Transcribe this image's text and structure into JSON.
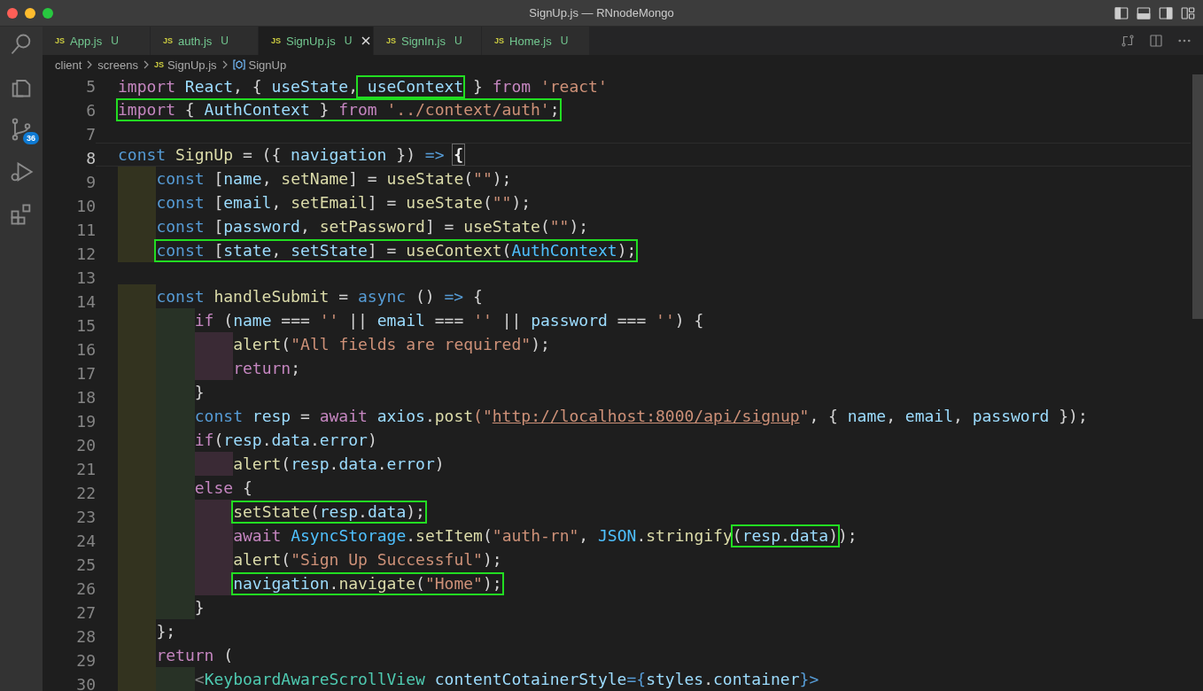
{
  "window": {
    "title": "SignUp.js — RNnodeMongo"
  },
  "activity_bar": {
    "source_control_badge": "36"
  },
  "tabs": [
    {
      "icon": "JS",
      "label": "App.js",
      "status": "U",
      "selected": false
    },
    {
      "icon": "JS",
      "label": "auth.js",
      "status": "U",
      "selected": false
    },
    {
      "icon": "JS",
      "label": "SignUp.js",
      "status": "U",
      "selected": true
    },
    {
      "icon": "JS",
      "label": "SignIn.js",
      "status": "U",
      "selected": false
    },
    {
      "icon": "JS",
      "label": "Home.js",
      "status": "U",
      "selected": false
    }
  ],
  "breadcrumbs": [
    {
      "kind": "folder",
      "label": "client"
    },
    {
      "kind": "folder",
      "label": "screens"
    },
    {
      "kind": "file",
      "icon": "JS",
      "label": "SignUp.js"
    },
    {
      "kind": "symbol",
      "label": "SignUp"
    }
  ],
  "editor": {
    "lines": [
      {
        "number": "5",
        "current": false,
        "parts": [
          {
            "boxed": false,
            "tokens": [
              {
                "text": "import",
                "kind": "keyword"
              },
              {
                "text": " React",
                "kind": "var"
              },
              {
                "text": ", { ",
                "kind": "punct"
              },
              {
                "text": "useState",
                "kind": "var"
              },
              {
                "text": ",",
                "kind": "punct"
              }
            ]
          },
          {
            "boxed": true,
            "tokens": [
              {
                "text": " useContext",
                "kind": "var"
              }
            ]
          },
          {
            "boxed": false,
            "tokens": [
              {
                "text": " } ",
                "kind": "punct"
              },
              {
                "text": "from",
                "kind": "keyword"
              },
              {
                "text": " 'react'",
                "kind": "string"
              }
            ]
          }
        ]
      },
      {
        "number": "6",
        "current": false,
        "parts": [
          {
            "boxed": true,
            "tokens": [
              {
                "text": "import",
                "kind": "keyword"
              },
              {
                "text": " { ",
                "kind": "punct"
              },
              {
                "text": "AuthContext",
                "kind": "var"
              },
              {
                "text": " } ",
                "kind": "punct"
              },
              {
                "text": "from",
                "kind": "keyword"
              },
              {
                "text": " '../context/auth'",
                "kind": "string"
              },
              {
                "text": ";",
                "kind": "punct"
              }
            ]
          }
        ]
      },
      {
        "number": "7",
        "current": false
      },
      {
        "number": "8",
        "current": true,
        "parts": [
          {
            "boxed": false,
            "tokens": [
              {
                "text": "const",
                "kind": "storage"
              },
              {
                "text": " SignUp",
                "kind": "function"
              },
              {
                "text": " = ({ ",
                "kind": "punct"
              },
              {
                "text": "navigation",
                "kind": "var"
              },
              {
                "text": " }) ",
                "kind": "punct"
              },
              {
                "text": "=>",
                "kind": "storage"
              },
              {
                "text": " {",
                "kind": "matched-bracket"
              }
            ]
          }
        ]
      },
      {
        "number": "9",
        "current": false,
        "parts": [
          {
            "boxed": false,
            "tokens": [
              {
                "text": "    const",
                "kind": "storage"
              },
              {
                "text": " [",
                "kind": "punct"
              },
              {
                "text": "name",
                "kind": "var"
              },
              {
                "text": ", ",
                "kind": "punct"
              },
              {
                "text": "setName",
                "kind": "function"
              },
              {
                "text": "] = ",
                "kind": "punct"
              },
              {
                "text": "useState",
                "kind": "function"
              },
              {
                "text": "(",
                "kind": "punct"
              },
              {
                "text": "\"\"",
                "kind": "string"
              },
              {
                "text": ");",
                "kind": "punct"
              }
            ]
          }
        ]
      },
      {
        "number": "10",
        "current": false,
        "parts": [
          {
            "boxed": false,
            "tokens": [
              {
                "text": "    const",
                "kind": "storage"
              },
              {
                "text": " [",
                "kind": "punct"
              },
              {
                "text": "email",
                "kind": "var"
              },
              {
                "text": ", ",
                "kind": "punct"
              },
              {
                "text": "setEmail",
                "kind": "function"
              },
              {
                "text": "] = ",
                "kind": "punct"
              },
              {
                "text": "useState",
                "kind": "function"
              },
              {
                "text": "(",
                "kind": "punct"
              },
              {
                "text": "\"\"",
                "kind": "string"
              },
              {
                "text": ");",
                "kind": "punct"
              }
            ]
          }
        ]
      },
      {
        "number": "11",
        "current": false,
        "parts": [
          {
            "boxed": false,
            "tokens": [
              {
                "text": "    const",
                "kind": "storage"
              },
              {
                "text": " [",
                "kind": "punct"
              },
              {
                "text": "password",
                "kind": "var"
              },
              {
                "text": ", ",
                "kind": "punct"
              },
              {
                "text": "setPassword",
                "kind": "function"
              },
              {
                "text": "] = ",
                "kind": "punct"
              },
              {
                "text": "useState",
                "kind": "function"
              },
              {
                "text": "(",
                "kind": "punct"
              },
              {
                "text": "\"\"",
                "kind": "string"
              },
              {
                "text": ");",
                "kind": "punct"
              }
            ]
          }
        ]
      },
      {
        "number": "12",
        "current": false,
        "parts": [
          {
            "boxed": true,
            "tokens": [
              {
                "text": "    const",
                "kind": "storage"
              },
              {
                "text": " [",
                "kind": "punct"
              },
              {
                "text": "state",
                "kind": "var"
              },
              {
                "text": ", ",
                "kind": "punct"
              },
              {
                "text": "setState",
                "kind": "var"
              },
              {
                "text": "] = ",
                "kind": "punct"
              },
              {
                "text": "useContext",
                "kind": "function"
              },
              {
                "text": "(",
                "kind": "punct"
              },
              {
                "text": "AuthContext",
                "kind": "constant"
              },
              {
                "text": ");",
                "kind": "punct"
              }
            ]
          }
        ]
      },
      {
        "number": "13",
        "current": false
      },
      {
        "number": "14",
        "current": false,
        "parts": [
          {
            "boxed": false,
            "tokens": [
              {
                "text": "    const",
                "kind": "storage"
              },
              {
                "text": " handleSubmit",
                "kind": "function"
              },
              {
                "text": " = ",
                "kind": "punct"
              },
              {
                "text": "async",
                "kind": "storage"
              },
              {
                "text": " () ",
                "kind": "punct"
              },
              {
                "text": "=>",
                "kind": "storage"
              },
              {
                "text": " {",
                "kind": "punct"
              }
            ]
          }
        ]
      },
      {
        "number": "15",
        "current": false,
        "parts": [
          {
            "boxed": false,
            "tokens": [
              {
                "text": "        if",
                "kind": "keyword"
              },
              {
                "text": " (",
                "kind": "punct"
              },
              {
                "text": "name",
                "kind": "var"
              },
              {
                "text": " === ",
                "kind": "punct"
              },
              {
                "text": "''",
                "kind": "string"
              },
              {
                "text": " || ",
                "kind": "punct"
              },
              {
                "text": "email",
                "kind": "var"
              },
              {
                "text": " === ",
                "kind": "punct"
              },
              {
                "text": "''",
                "kind": "string"
              },
              {
                "text": " || ",
                "kind": "punct"
              },
              {
                "text": "password",
                "kind": "var"
              },
              {
                "text": " === ",
                "kind": "punct"
              },
              {
                "text": "''",
                "kind": "string"
              },
              {
                "text": ") {",
                "kind": "punct"
              }
            ]
          }
        ]
      },
      {
        "number": "16",
        "current": false,
        "parts": [
          {
            "boxed": false,
            "tokens": [
              {
                "text": "            alert",
                "kind": "function"
              },
              {
                "text": "(",
                "kind": "punct"
              },
              {
                "text": "\"All fields are required\"",
                "kind": "string"
              },
              {
                "text": ");",
                "kind": "punct"
              }
            ]
          }
        ]
      },
      {
        "number": "17",
        "current": false,
        "parts": [
          {
            "boxed": false,
            "tokens": [
              {
                "text": "            return",
                "kind": "keyword"
              },
              {
                "text": ";",
                "kind": "punct"
              }
            ]
          }
        ]
      },
      {
        "number": "18",
        "current": false,
        "parts": [
          {
            "boxed": false,
            "tokens": [
              {
                "text": "        }",
                "kind": "punct"
              }
            ]
          }
        ]
      },
      {
        "number": "19",
        "current": false,
        "parts": [
          {
            "boxed": false,
            "tokens": [
              {
                "text": "        const",
                "kind": "storage"
              },
              {
                "text": " resp",
                "kind": "var"
              },
              {
                "text": " = ",
                "kind": "punct"
              },
              {
                "text": "await",
                "kind": "keyword"
              },
              {
                "text": " axios",
                "kind": "var"
              },
              {
                "text": ".",
                "kind": "punct"
              },
              {
                "text": "post",
                "kind": "function"
              },
              {
                "text": "(\"",
                "kind": "string"
              },
              {
                "text": "http://localhost:8000/api/signup",
                "kind": "link"
              },
              {
                "text": "\"",
                "kind": "string"
              },
              {
                "text": ", { ",
                "kind": "punct"
              },
              {
                "text": "name",
                "kind": "var"
              },
              {
                "text": ", ",
                "kind": "punct"
              },
              {
                "text": "email",
                "kind": "var"
              },
              {
                "text": ", ",
                "kind": "punct"
              },
              {
                "text": "password",
                "kind": "var"
              },
              {
                "text": " });",
                "kind": "punct"
              }
            ]
          }
        ]
      },
      {
        "number": "20",
        "current": false,
        "parts": [
          {
            "boxed": false,
            "tokens": [
              {
                "text": "        if",
                "kind": "keyword"
              },
              {
                "text": "(",
                "kind": "punct"
              },
              {
                "text": "resp",
                "kind": "var"
              },
              {
                "text": ".",
                "kind": "punct"
              },
              {
                "text": "data",
                "kind": "var"
              },
              {
                "text": ".",
                "kind": "punct"
              },
              {
                "text": "error",
                "kind": "var"
              },
              {
                "text": ")",
                "kind": "punct"
              }
            ]
          }
        ]
      },
      {
        "number": "21",
        "current": false,
        "parts": [
          {
            "boxed": false,
            "tokens": [
              {
                "text": "            alert",
                "kind": "function"
              },
              {
                "text": "(",
                "kind": "punct"
              },
              {
                "text": "resp",
                "kind": "var"
              },
              {
                "text": ".",
                "kind": "punct"
              },
              {
                "text": "data",
                "kind": "var"
              },
              {
                "text": ".",
                "kind": "punct"
              },
              {
                "text": "error",
                "kind": "var"
              },
              {
                "text": ")",
                "kind": "punct"
              }
            ]
          }
        ]
      },
      {
        "number": "22",
        "current": false,
        "parts": [
          {
            "boxed": false,
            "tokens": [
              {
                "text": "        else",
                "kind": "keyword"
              },
              {
                "text": " {",
                "kind": "punct"
              }
            ]
          }
        ]
      },
      {
        "number": "23",
        "current": false,
        "parts": [
          {
            "boxed": true,
            "tokens": [
              {
                "text": "            setState",
                "kind": "function"
              },
              {
                "text": "(",
                "kind": "punct"
              },
              {
                "text": "resp",
                "kind": "var"
              },
              {
                "text": ".",
                "kind": "punct"
              },
              {
                "text": "data",
                "kind": "var"
              },
              {
                "text": ");",
                "kind": "punct"
              }
            ]
          }
        ]
      },
      {
        "number": "24",
        "current": false,
        "parts": [
          {
            "boxed": false,
            "tokens": [
              {
                "text": "            await",
                "kind": "keyword"
              },
              {
                "text": " AsyncStorage",
                "kind": "constant"
              },
              {
                "text": ".",
                "kind": "punct"
              },
              {
                "text": "setItem",
                "kind": "function"
              },
              {
                "text": "(",
                "kind": "punct"
              },
              {
                "text": "\"auth-rn\"",
                "kind": "string"
              },
              {
                "text": ", ",
                "kind": "punct"
              },
              {
                "text": "JSON",
                "kind": "constant"
              },
              {
                "text": ".",
                "kind": "punct"
              },
              {
                "text": "stringify",
                "kind": "function"
              }
            ]
          },
          {
            "boxed": true,
            "tokens": [
              {
                "text": "(",
                "kind": "punct"
              },
              {
                "text": "resp",
                "kind": "var"
              },
              {
                "text": ".",
                "kind": "punct"
              },
              {
                "text": "data",
                "kind": "var"
              },
              {
                "text": ")",
                "kind": "punct"
              }
            ]
          },
          {
            "boxed": false,
            "tokens": [
              {
                "text": ");",
                "kind": "punct"
              }
            ]
          }
        ]
      },
      {
        "number": "25",
        "current": false,
        "parts": [
          {
            "boxed": false,
            "tokens": [
              {
                "text": "            alert",
                "kind": "function"
              },
              {
                "text": "(",
                "kind": "punct"
              },
              {
                "text": "\"Sign Up Successful\"",
                "kind": "string"
              },
              {
                "text": ");",
                "kind": "punct"
              }
            ]
          }
        ]
      },
      {
        "number": "26",
        "current": false,
        "parts": [
          {
            "boxed": true,
            "tokens": [
              {
                "text": "            navigation",
                "kind": "var"
              },
              {
                "text": ".",
                "kind": "punct"
              },
              {
                "text": "navigate",
                "kind": "function"
              },
              {
                "text": "(",
                "kind": "punct"
              },
              {
                "text": "\"Home\"",
                "kind": "string"
              },
              {
                "text": ");",
                "kind": "punct"
              }
            ]
          }
        ]
      },
      {
        "number": "27",
        "current": false,
        "parts": [
          {
            "boxed": false,
            "tokens": [
              {
                "text": "        }",
                "kind": "punct"
              }
            ]
          }
        ]
      },
      {
        "number": "28",
        "current": false,
        "parts": [
          {
            "boxed": false,
            "tokens": [
              {
                "text": "    };",
                "kind": "punct"
              }
            ]
          }
        ]
      },
      {
        "number": "29",
        "current": false,
        "parts": [
          {
            "boxed": false,
            "tokens": [
              {
                "text": "    return",
                "kind": "keyword"
              },
              {
                "text": " (",
                "kind": "punct"
              }
            ]
          }
        ]
      },
      {
        "number": "30",
        "current": false,
        "parts": [
          {
            "boxed": false,
            "tokens": [
              {
                "text": "        <",
                "kind": "tag-punct"
              },
              {
                "text": "KeyboardAwareScrollView",
                "kind": "type"
              },
              {
                "text": " contentCotainerStyle",
                "kind": "var"
              },
              {
                "text": "={",
                "kind": "storage"
              },
              {
                "text": "styles",
                "kind": "var"
              },
              {
                "text": ".",
                "kind": "punct"
              },
              {
                "text": "container",
                "kind": "var"
              },
              {
                "text": "}>",
                "kind": "storage"
              }
            ]
          }
        ]
      }
    ]
  }
}
